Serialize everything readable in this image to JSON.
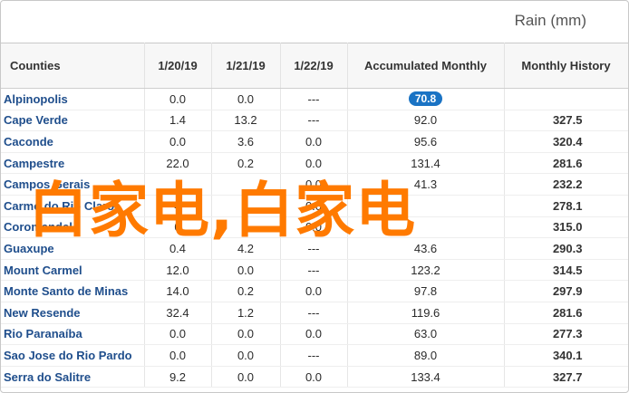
{
  "unit_label": "Rain (mm)",
  "columns": [
    "Counties",
    "1/20/19",
    "1/21/19",
    "1/22/19",
    "Accumulated Monthly",
    "Monthly History"
  ],
  "rows": [
    {
      "county": "Alpinopolis",
      "d1": "0.0",
      "d2": "0.0",
      "d3": "---",
      "acc": "70.8",
      "hist": ""
    },
    {
      "county": "Cape Verde",
      "d1": "1.4",
      "d2": "13.2",
      "d3": "---",
      "acc": "92.0",
      "hist": "327.5"
    },
    {
      "county": "Caconde",
      "d1": "0.0",
      "d2": "3.6",
      "d3": "0.0",
      "acc": "95.6",
      "hist": "320.4"
    },
    {
      "county": "Campestre",
      "d1": "22.0",
      "d2": "0.2",
      "d3": "0.0",
      "acc": "131.4",
      "hist": "281.6"
    },
    {
      "county": "Campos Gerais",
      "d1": "",
      "d2": "",
      "d3": "0.0",
      "acc": "41.3",
      "hist": "232.2"
    },
    {
      "county": "Carmo do Rio Claro",
      "d1": "4",
      "d2": "",
      "d3": "0.0",
      "acc": "",
      "hist": "278.1"
    },
    {
      "county": "Coromandel",
      "d1": "0",
      "d2": "",
      "d3": "0.0",
      "acc": "",
      "hist": "315.0"
    },
    {
      "county": "Guaxupe",
      "d1": "0.4",
      "d2": "4.2",
      "d3": "---",
      "acc": "43.6",
      "hist": "290.3"
    },
    {
      "county": "Mount Carmel",
      "d1": "12.0",
      "d2": "0.0",
      "d3": "---",
      "acc": "123.2",
      "hist": "314.5"
    },
    {
      "county": "Monte Santo de Minas",
      "d1": "14.0",
      "d2": "0.2",
      "d3": "0.0",
      "acc": "97.8",
      "hist": "297.9"
    },
    {
      "county": "New Resende",
      "d1": "32.4",
      "d2": "1.2",
      "d3": "---",
      "acc": "119.6",
      "hist": "281.6"
    },
    {
      "county": "Rio Paranaíba",
      "d1": "0.0",
      "d2": "0.0",
      "d3": "0.0",
      "acc": "63.0",
      "hist": "277.3"
    },
    {
      "county": "Sao Jose do Rio Pardo",
      "d1": "0.0",
      "d2": "0.0",
      "d3": "---",
      "acc": "89.0",
      "hist": "340.1"
    },
    {
      "county": "Serra do Salitre",
      "d1": "9.2",
      "d2": "0.0",
      "d3": "0.0",
      "acc": "133.4",
      "hist": "327.7"
    }
  ],
  "watermark": "白家电,白家电",
  "colors": {
    "accent": "#1a73c4",
    "watermark": "#ff7a00",
    "county_text": "#1f4e8c"
  }
}
